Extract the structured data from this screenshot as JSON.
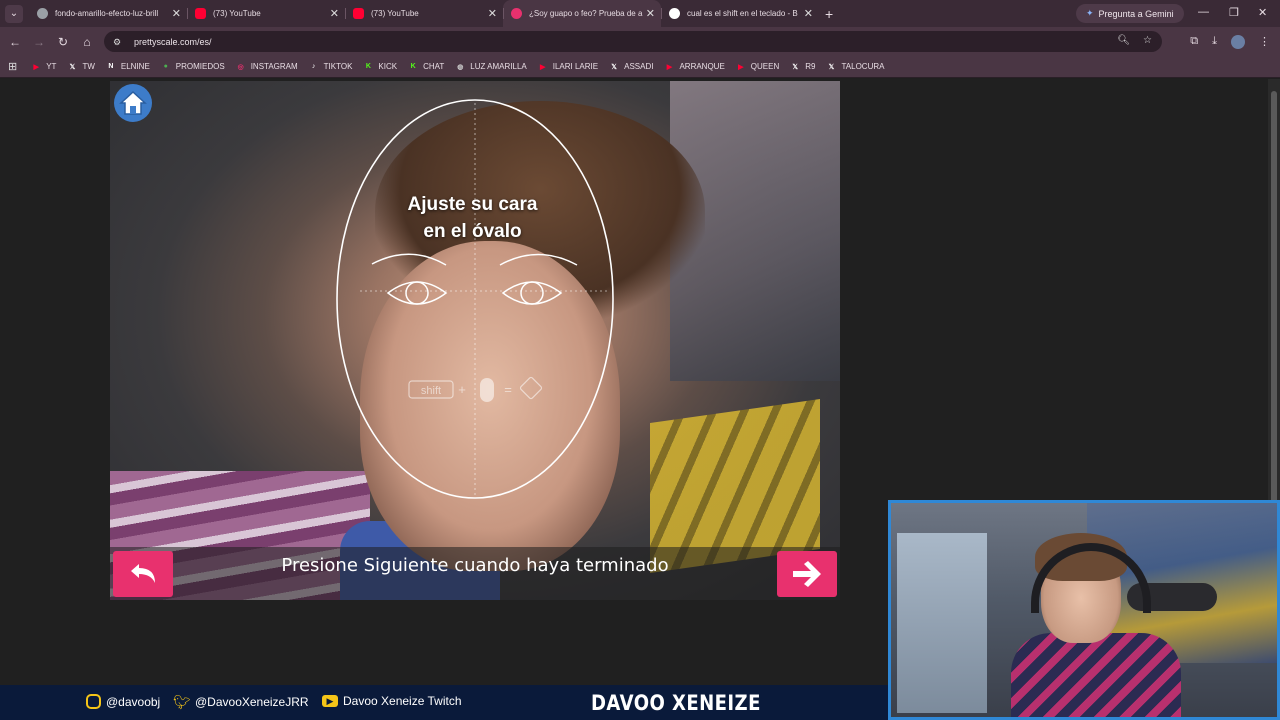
{
  "browser": {
    "tabs": [
      {
        "title": "fondo-amarillo-efecto-luz-brill",
        "favicon_color": "#9aa0a6",
        "active": false
      },
      {
        "title": "(73) YouTube",
        "favicon_color": "#ff0033",
        "active": false
      },
      {
        "title": "(73) YouTube",
        "favicon_color": "#ff0033",
        "active": false
      },
      {
        "title": "¿Soy guapo o feo? Prueba de a",
        "favicon_color": "#e8316e",
        "active": true
      },
      {
        "title": "cual es el shift en el teclado - B",
        "favicon_color": "#ffffff",
        "active": false
      }
    ],
    "gemini_label": "Pregunta a Gemini",
    "url": "prettyscale.com/es/",
    "bookmarks": [
      {
        "label": "YT",
        "icon": "youtube-icon",
        "color": "#ff0033"
      },
      {
        "label": "TW",
        "icon": "x-icon",
        "color": "#ffffff"
      },
      {
        "label": "ELNINE",
        "icon": "n-icon",
        "color": "#ffffff"
      },
      {
        "label": "PROMIEDOS",
        "icon": "ball-icon",
        "color": "#4caf50"
      },
      {
        "label": "INSTAGRAM",
        "icon": "instagram-icon",
        "color": "#e1306c"
      },
      {
        "label": "TIKTOK",
        "icon": "tiktok-icon",
        "color": "#ffffff"
      },
      {
        "label": "KICK",
        "icon": "kick-icon",
        "color": "#53fc18"
      },
      {
        "label": "CHAT",
        "icon": "kick-icon",
        "color": "#53fc18"
      },
      {
        "label": "LUZ AMARILLA",
        "icon": "globe-icon",
        "color": "#cccccc"
      },
      {
        "label": "ILARI LARIE",
        "icon": "youtube-icon",
        "color": "#ff0033"
      },
      {
        "label": "ASSADI",
        "icon": "x-icon",
        "color": "#ffffff"
      },
      {
        "label": "ARRANQUE",
        "icon": "youtube-icon",
        "color": "#ff0033"
      },
      {
        "label": "QUEEN",
        "icon": "youtube-icon",
        "color": "#ff0033"
      },
      {
        "label": "R9",
        "icon": "x-icon",
        "color": "#ffffff"
      },
      {
        "label": "TALOCURA",
        "icon": "x-icon",
        "color": "#ffffff"
      }
    ]
  },
  "app": {
    "prompt_line1": "Ajuste su cara",
    "prompt_line2": "en el óvalo",
    "hint_key": "shift",
    "instruction": "Presione Siguiente cuando haya terminado",
    "accent_color": "#e8316e"
  },
  "footer": {
    "instagram": "@davoobj",
    "twitter": "@DavooXeneizeJRR",
    "twitch": "Davoo Xeneize Twitch",
    "brand": "DAVOO XENEIZE"
  }
}
